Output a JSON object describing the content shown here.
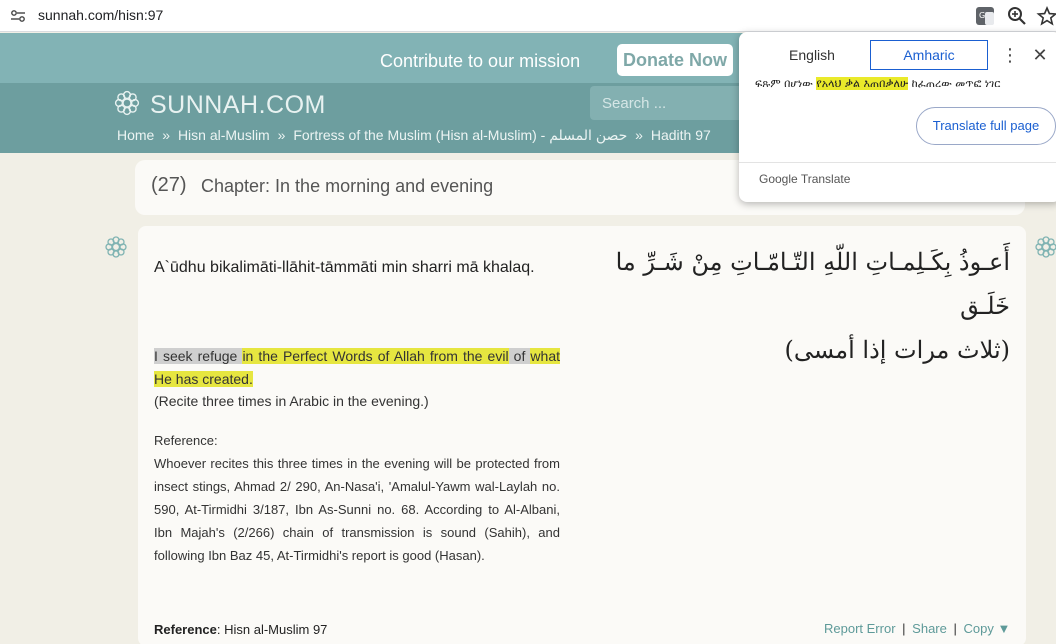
{
  "browser": {
    "url": "sunnah.com/hisn:97"
  },
  "banner": {
    "message": "Contribute to our mission",
    "donate_label": "Donate Now"
  },
  "header": {
    "logo_text": "SUNNAH.COM",
    "search_placeholder": "Search ..."
  },
  "breadcrumb": {
    "home": "Home",
    "sep1": "»",
    "book": "Hisn al-Muslim",
    "sep2": "»",
    "collection": "Fortress of the Muslim (Hisn al-Muslim) - حصن المسلم",
    "sep3": "»",
    "hadith": "Hadith 97"
  },
  "chapter": {
    "number": "(27)",
    "title": "Chapter: In the morning and evening"
  },
  "hadith": {
    "transliteration": "A`ūdhu bikalimāti-llāhit-tāmmāti min sharri mā khalaq.",
    "english_pre": "I seek refuge ",
    "english_hl": "in the Perfect Words of Allah from the evil",
    "english_mid": " of ",
    "english_hl2": "what He has created.",
    "recite_note": "(Recite three times in Arabic in the evening.)",
    "reference_heading": "Reference:",
    "reference_body": "Whoever recites this three times in the evening will be protected from insect stings, Ahmad 2/ 290, An-Nasa'i, 'Amalul-Yawm wal-Laylah no. 590, At-Tirmidhi 3/187, Ibn As-Sunni no. 68. According to Al-Albani, Ibn Majah's (2/266) chain of transmission is sound (Sahih), and following Ibn Baz 45, At-Tirmidhi's report is good (Hasan).",
    "arabic_line1": "أَعـوذُ بِكَـلِمـاتِ اللّهِ التّـامّـاتِ مِنْ شَـرِّ ما خَلَـق",
    "arabic_line2": "(ثلاث مرات إذا أمسى)",
    "footer_ref_label": "Reference",
    "footer_ref_value": ": Hisn al-Muslim 97",
    "action_report": "Report Error",
    "action_share": "Share",
    "action_copy": "Copy ▼",
    "action_sep": "|"
  },
  "translate_popup": {
    "tab_source": "English",
    "tab_target": "Amharic",
    "more_icon": "⋮",
    "close_icon": "✕",
    "text_pre": "ፍጹም በሆነው ",
    "text_hl": "የአላህ ቃል እጠበቃለሁ",
    "text_post": " ከፈጠረው መጥፎ ነገር",
    "full_page_label": "Translate full page",
    "brand": "Google Translate"
  },
  "colors": {
    "banner": "#82b3b5",
    "nav": "#6d9e9f",
    "page_bg": "#f1efe6",
    "highlight": "#e6e640",
    "link": "#5e9a99",
    "translate_blue": "#1a5fd1"
  }
}
